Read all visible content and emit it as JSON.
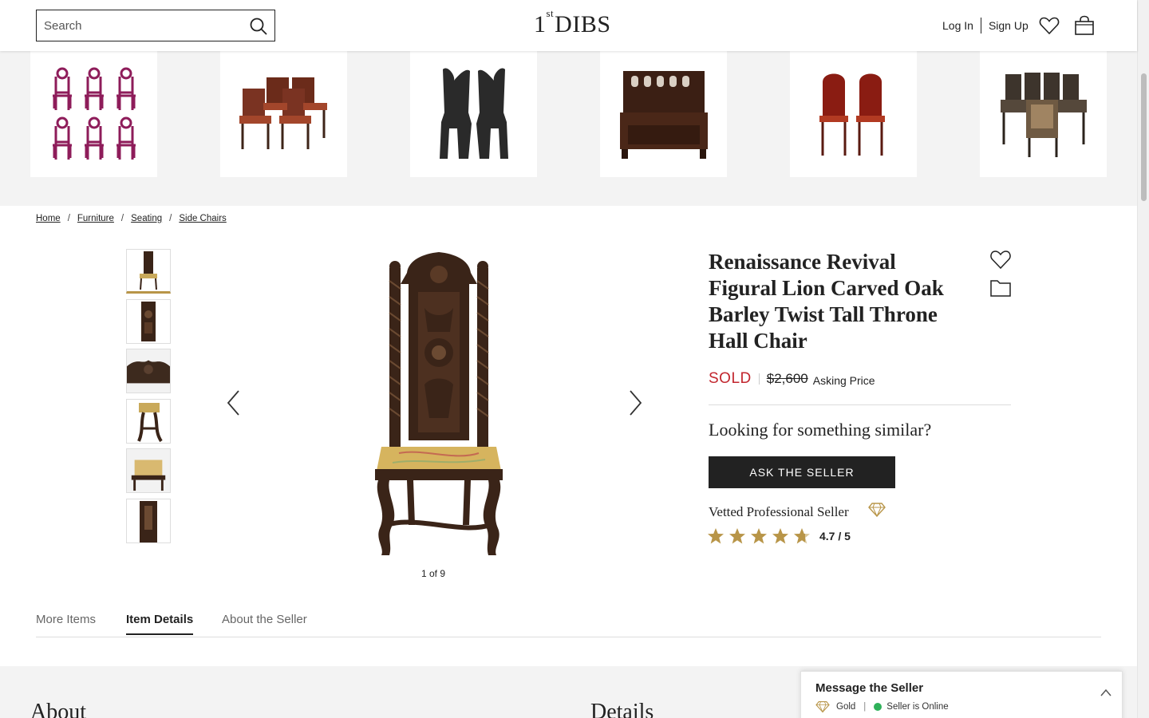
{
  "header": {
    "search_placeholder": "Search",
    "logo_text": "DIBS",
    "logo_prefix": "1",
    "logo_sup": "st",
    "login": "Log In",
    "signup": "Sign Up"
  },
  "carousel": {
    "items": [
      {
        "alt": "purple chairs set"
      },
      {
        "alt": "leather chairs set"
      },
      {
        "alt": "carved dark chairs pair"
      },
      {
        "alt": "carved hall bench"
      },
      {
        "alt": "red chairs pair"
      },
      {
        "alt": "carved chairs set"
      }
    ]
  },
  "breadcrumb": {
    "items": [
      "Home",
      "Furniture",
      "Seating",
      "Side Chairs"
    ],
    "separator": "/"
  },
  "gallery": {
    "counter": "1 of 9"
  },
  "product": {
    "title": "Renaissance Revival Figural Lion Carved Oak Barley Twist Tall Throne Hall Chair",
    "status": "SOLD",
    "price": "$2,600",
    "price_note": "Asking Price",
    "similar_heading": "Looking for something similar?",
    "ask_button": "ASK THE SELLER",
    "seller_label": "Vetted Professional Seller",
    "rating": "4.7 / 5",
    "rating_value": 4.7,
    "star_color": "#b89548"
  },
  "tabs": {
    "items": [
      "More Items",
      "Item Details",
      "About the Seller"
    ],
    "active": "Item Details"
  },
  "sections": {
    "about": "About",
    "details": "Details"
  },
  "message_panel": {
    "title": "Message the Seller",
    "tier": "Gold",
    "separator": "|",
    "status": "Seller is Online",
    "status_color": "#2fb15a"
  }
}
